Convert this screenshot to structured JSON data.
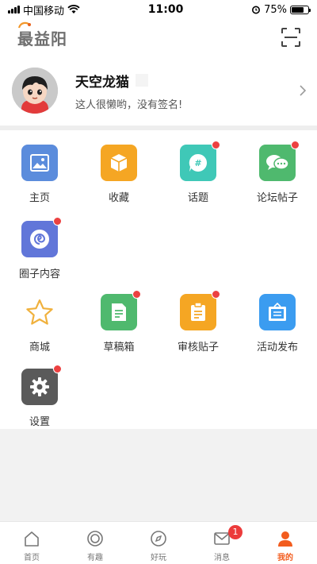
{
  "status_bar": {
    "carrier": "中国移动",
    "time": "11:00",
    "battery_pct": "75%",
    "battery_level": 0.75
  },
  "header": {
    "logo_text": "最益阳",
    "scan_icon": "scan-icon"
  },
  "profile": {
    "nickname": "天空龙猫",
    "signature": "这人很懒哟，没有签名!"
  },
  "section1": [
    {
      "label": "主页",
      "icon": "image-icon",
      "color": "#5b8cdc",
      "badge": false
    },
    {
      "label": "收藏",
      "icon": "box-icon",
      "color": "#f5a623",
      "badge": false
    },
    {
      "label": "话题",
      "icon": "hashtag-icon",
      "color": "#3fc8b7",
      "badge": true
    },
    {
      "label": "论坛帖子",
      "icon": "chat-icon",
      "color": "#4fb96e",
      "badge": true
    },
    {
      "label": "圈子内容",
      "icon": "circle-spiral-icon",
      "color": "#6176d9",
      "badge": true
    }
  ],
  "section2": [
    {
      "label": "商城",
      "icon": "star-icon",
      "color": "#f0b13d",
      "badge": false
    },
    {
      "label": "草稿箱",
      "icon": "draft-icon",
      "color": "#4fb96e",
      "badge": true
    },
    {
      "label": "审核贴子",
      "icon": "clipboard-icon",
      "color": "#f5a623",
      "badge": true
    },
    {
      "label": "活动发布",
      "icon": "event-icon",
      "color": "#3b9cf0",
      "badge": false
    },
    {
      "label": "设置",
      "icon": "gear-icon",
      "color": "#5a5a5a",
      "badge": true
    }
  ],
  "bottom_nav": [
    {
      "label": "首页",
      "icon": "home-icon"
    },
    {
      "label": "有趣",
      "icon": "circle-icon"
    },
    {
      "label": "好玩",
      "icon": "compass-icon"
    },
    {
      "label": "消息",
      "icon": "mail-icon",
      "badge": "1"
    },
    {
      "label": "我的",
      "icon": "user-icon",
      "active": true
    }
  ],
  "accent_color": "#f25c1e"
}
